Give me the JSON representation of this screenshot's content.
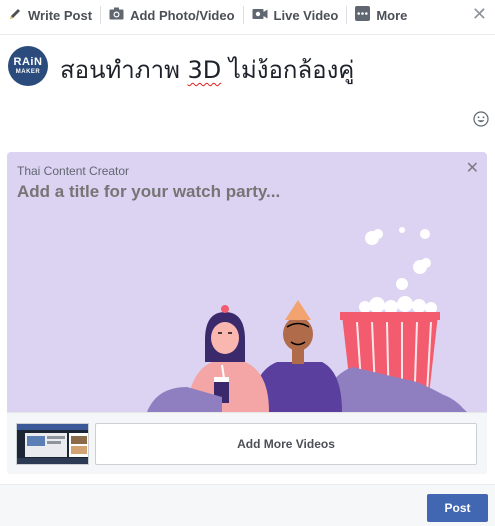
{
  "tabs": [
    {
      "label": "Write Post",
      "icon": "pencil-icon"
    },
    {
      "label": "Add Photo/Video",
      "icon": "camera-icon"
    },
    {
      "label": "Live Video",
      "icon": "video-camera-icon"
    },
    {
      "label": "More",
      "icon": "more-dots-icon"
    }
  ],
  "avatar": {
    "line1": "RAiN",
    "line2": "MAKER",
    "color": "#2a4b7c"
  },
  "composer": {
    "text_before": "สอนทำภาพ ",
    "text_misspelled": "3D",
    "text_after": " ไม่ง้อกล้องคู่"
  },
  "watch_party": {
    "owner": "Thai Content Creator",
    "title_placeholder": "Add a title for your watch party...",
    "background_color": "#dcd2f2",
    "add_more_label": "Add More Videos"
  },
  "footer": {
    "post_label": "Post",
    "post_color": "#4267b2"
  }
}
